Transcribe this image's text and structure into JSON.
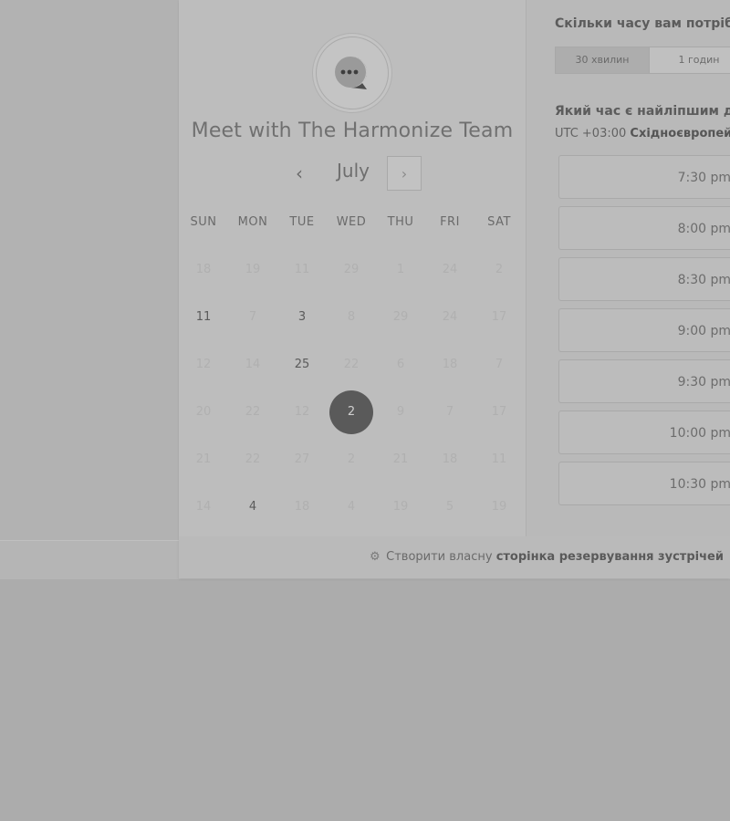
{
  "header": {
    "title": "Meet with The Harmonize Team",
    "avatar_icon": "chat-bubble-icon"
  },
  "calendar": {
    "month": "July",
    "prev_icon": "‹",
    "next_icon": "›",
    "weekdays": [
      "SUN",
      "MON",
      "TUE",
      "WED",
      "THU",
      "FRI",
      "SAT"
    ],
    "weeks": [
      [
        "18",
        "19",
        "11",
        "29",
        "1",
        "24",
        "2"
      ],
      [
        "11",
        "7",
        "3",
        "8",
        "29",
        "24",
        "17"
      ],
      [
        "12",
        "14",
        "25",
        "22",
        "6",
        "18",
        "7"
      ],
      [
        "20",
        "22",
        "12",
        "2",
        "9",
        "7",
        "17"
      ],
      [
        "21",
        "22",
        "27",
        "2",
        "21",
        "18",
        "11"
      ],
      [
        "14",
        "4",
        "18",
        "4",
        "19",
        "5",
        "19"
      ]
    ],
    "active_days": [
      "1-0",
      "1-2",
      "2-2",
      "5-1"
    ],
    "selected_day": "3-3"
  },
  "duration": {
    "title": "Скільки часу вам потрібн",
    "options": [
      "30 хвилин",
      "1 годин"
    ],
    "selected": "30 хвилин"
  },
  "times": {
    "title": "Який час є найліпшим дл",
    "timezone_prefix": "UTC +03:00",
    "timezone_name": "Східноєвропейсь",
    "slots": [
      "7:30 pm",
      "8:00 pm",
      "8:30 pm",
      "9:00 pm",
      "9:30 pm",
      "10:00 pm",
      "10:30 pm"
    ]
  },
  "footer": {
    "icon": "hubspot-sprocket-icon",
    "text_prefix": "Створити власну",
    "text_bold": "сторінка резервування зустрічей"
  },
  "colors": {
    "page_bg": "#acacac",
    "selected_day_bg": "#5a5a5a",
    "text_dark": "#5c5c5c"
  }
}
